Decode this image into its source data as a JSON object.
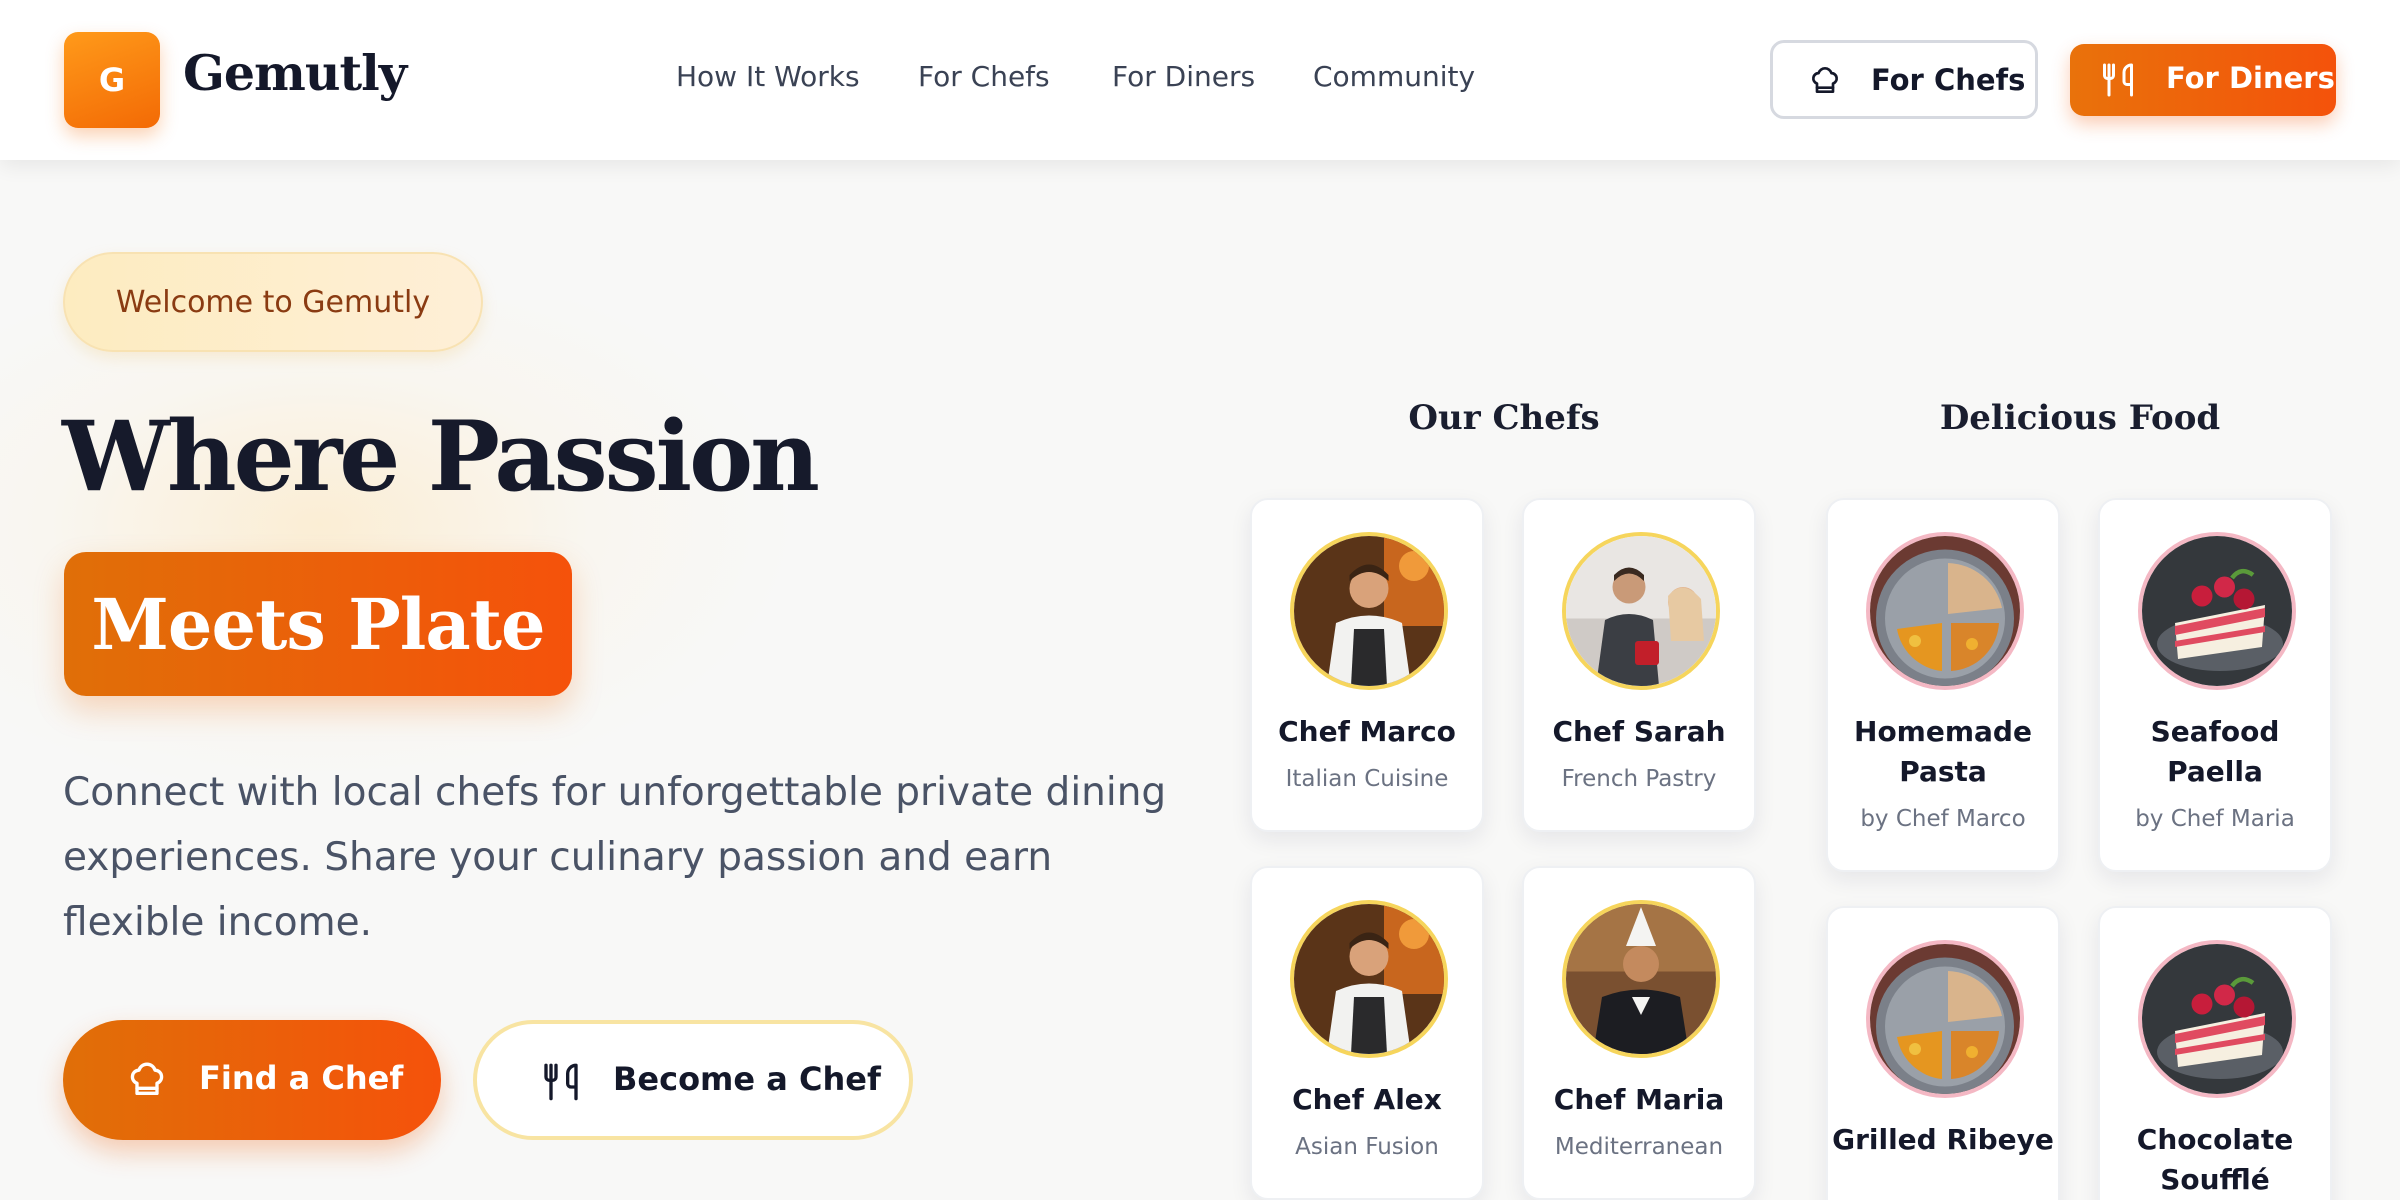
{
  "brand": {
    "logo_letter": "G",
    "name": "Gemutly"
  },
  "nav": {
    "links": [
      "How It Works",
      "For Chefs",
      "For Diners",
      "Community"
    ],
    "buttons": {
      "chefs": "For Chefs",
      "diners": "For Diners"
    }
  },
  "hero": {
    "badge": "Welcome to Gemutly",
    "headline_line1": "Where Passion",
    "headline_line2": "Meets Plate",
    "description": "Connect with local chefs for unforgettable private dining experiences. Share your culinary passion and earn flexible income.",
    "cta_primary": "Find a Chef",
    "cta_secondary": "Become a Chef"
  },
  "chefs": {
    "title": "Our Chefs",
    "items": [
      {
        "name": "Chef Marco",
        "specialty": "Italian Cuisine"
      },
      {
        "name": "Chef Sarah",
        "specialty": "French Pastry"
      },
      {
        "name": "Chef Alex",
        "specialty": "Asian Fusion"
      },
      {
        "name": "Chef Maria",
        "specialty": "Mediterranean"
      }
    ]
  },
  "food": {
    "title": "Delicious Food",
    "items": [
      {
        "name": "Homemade Pasta",
        "chef": "by Chef Marco"
      },
      {
        "name": "Seafood Paella",
        "chef": "by Chef Maria"
      },
      {
        "name": "Grilled Ribeye",
        "chef": ""
      },
      {
        "name": "Chocolate Soufflé",
        "chef": ""
      }
    ]
  },
  "colors": {
    "accent": "#f06a0a",
    "accent_dark": "#e06f08",
    "badge_bg": "#fdecc0",
    "badge_text": "#8a3b12",
    "heading": "#161a2b",
    "chef_ring": "#f6d55c",
    "food_ring": "#f4b8c4"
  },
  "icons": {
    "chef_hat": "chef-hat-icon",
    "utensils": "utensils-icon"
  }
}
